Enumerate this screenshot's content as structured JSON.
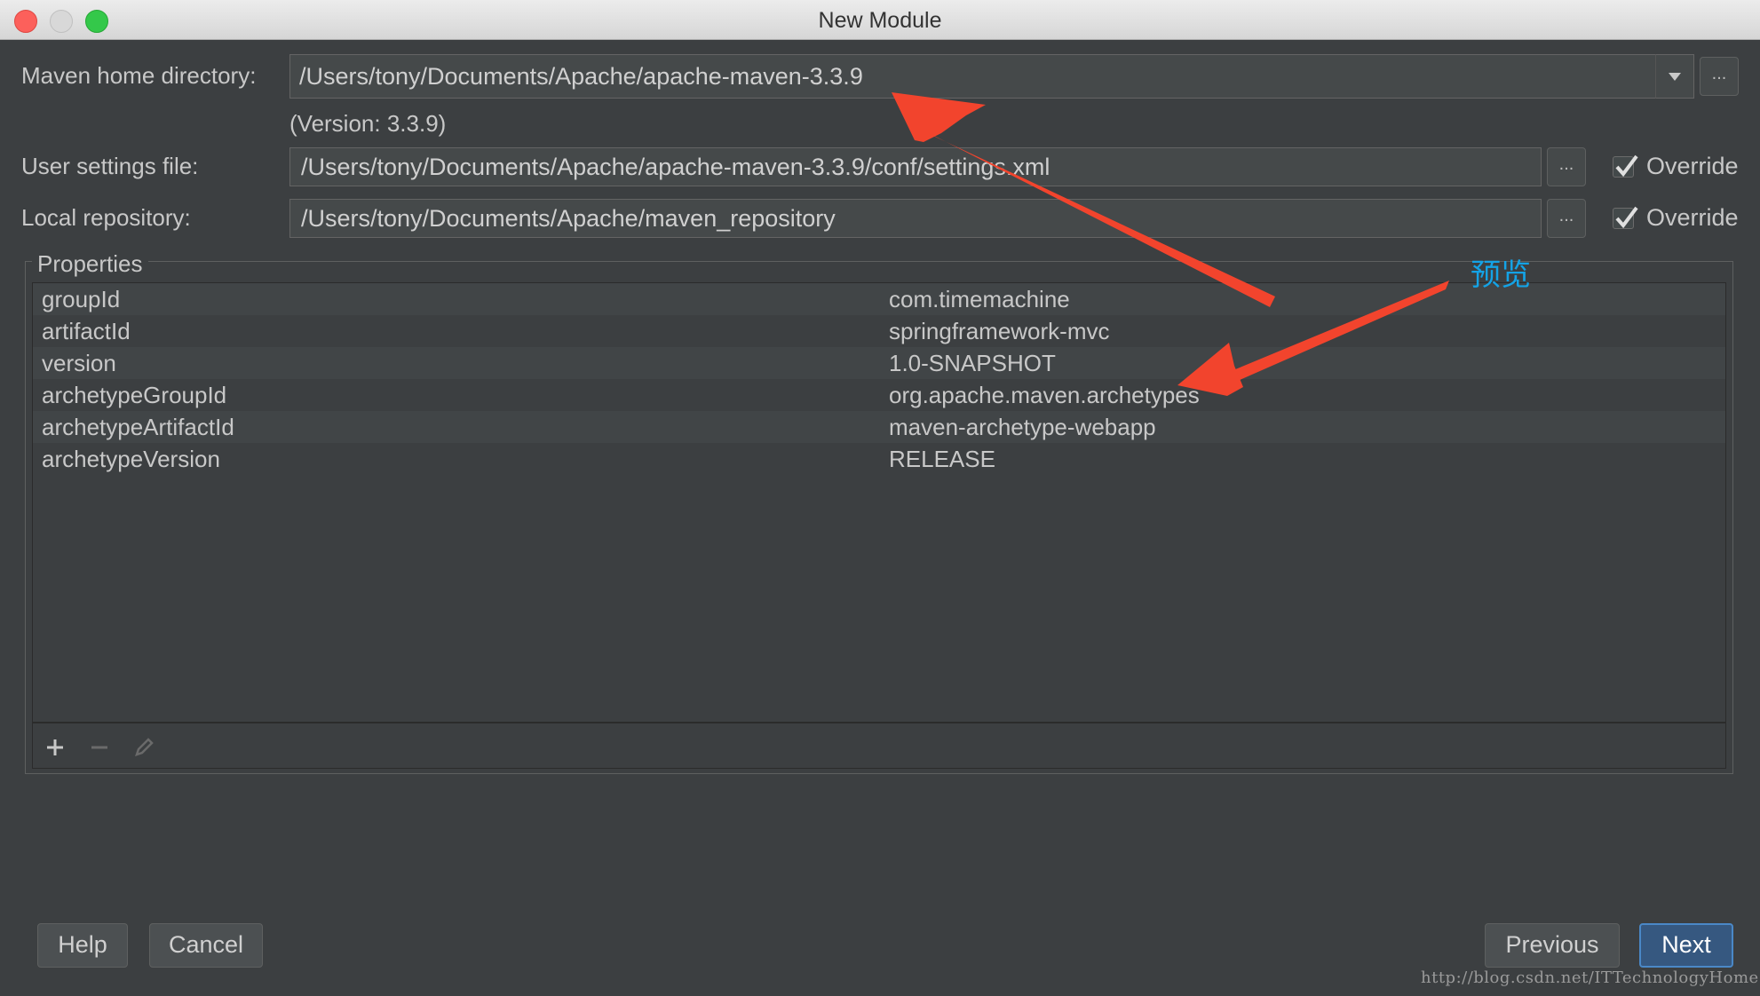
{
  "window": {
    "title": "New Module"
  },
  "maven": {
    "home_label": "Maven home directory:",
    "home_value": "/Users/tony/Documents/Apache/apache-maven-3.3.9",
    "version_text": "(Version: 3.3.9)",
    "settings_label": "User settings file:",
    "settings_value": "/Users/tony/Documents/Apache/apache-maven-3.3.9/conf/settings.xml",
    "repo_label": "Local repository:",
    "repo_value": "/Users/tony/Documents/Apache/maven_repository",
    "override_label": "Override",
    "browse_label": "...",
    "settings_override_checked": true,
    "repo_override_checked": true
  },
  "properties": {
    "title": "Properties",
    "rows": [
      {
        "key": "groupId",
        "value": "com.timemachine"
      },
      {
        "key": "artifactId",
        "value": "springframework-mvc"
      },
      {
        "key": "version",
        "value": "1.0-SNAPSHOT"
      },
      {
        "key": "archetypeGroupId",
        "value": "org.apache.maven.archetypes"
      },
      {
        "key": "archetypeArtifactId",
        "value": "maven-archetype-webapp"
      },
      {
        "key": "archetypeVersion",
        "value": "RELEASE"
      }
    ],
    "toolbar_icons": [
      "add-icon",
      "remove-icon",
      "edit-icon"
    ]
  },
  "buttons": {
    "help": "Help",
    "cancel": "Cancel",
    "previous": "Previous",
    "next": "Next"
  },
  "annotation": {
    "text": "预览",
    "color": "#14a3e6",
    "arrow_color": "#f2442d"
  },
  "watermark": "http://blog.csdn.net/ITTechnologyHome",
  "colors": {
    "background": "#3c3f41",
    "field": "#45494a",
    "default_button": "#365880"
  }
}
